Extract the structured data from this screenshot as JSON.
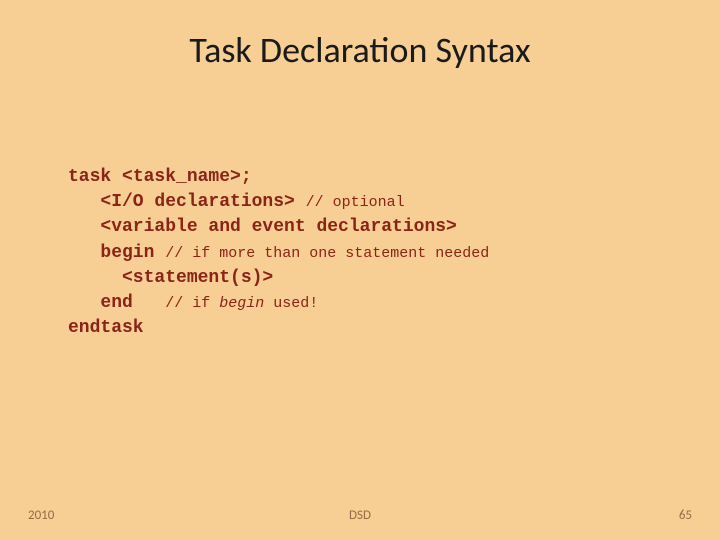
{
  "title": "Task Declaration Syntax",
  "code": {
    "kw_task": "task",
    "task_name": " <task_name>;",
    "io": "   <I/O declarations> ",
    "c_optional": "// optional",
    "vars": "   <variable and event declarations>",
    "begin": "   begin ",
    "c_begin": "// if more than one statement needed",
    "stmt": "     <statement(s)>",
    "end": "   end   ",
    "c_end_prefix": "// if ",
    "c_end_italic": "begin",
    "c_end_suffix": " used!",
    "endtask": "endtask"
  },
  "footer": {
    "year": "2010",
    "center": "DSD",
    "page": "65"
  }
}
